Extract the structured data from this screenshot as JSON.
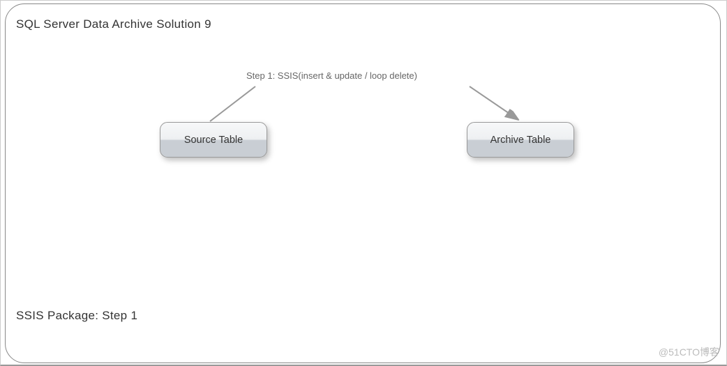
{
  "title": "SQL Server Data Archive Solution  9",
  "step_label": "Step 1:  SSIS(insert & update / loop delete)",
  "nodes": {
    "source": "Source Table",
    "archive": "Archive Table"
  },
  "footer": "SSIS Package:  Step 1",
  "watermark": "@51CTO博客"
}
